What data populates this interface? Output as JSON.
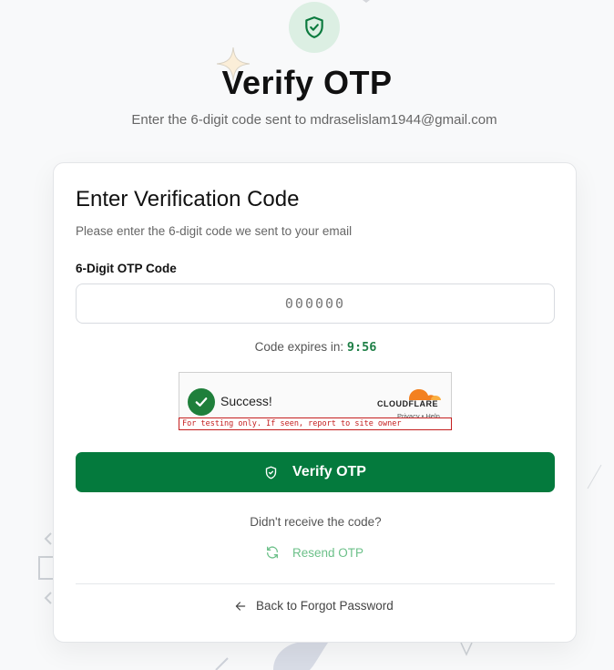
{
  "header": {
    "title": "Verify OTP",
    "subtitle": "Enter the 6-digit code sent to mdraselislam1944@gmail.com"
  },
  "card": {
    "title": "Enter Verification Code",
    "description": "Please enter the 6-digit code we sent to your email",
    "otp_label": "6-Digit OTP Code",
    "otp_placeholder": "000000",
    "otp_value": "",
    "expires_label": "Code expires in:",
    "expires_timer": "9:56"
  },
  "captcha": {
    "status": "Success!",
    "brand": "CLOUDFLARE",
    "links": "Privacy • Help",
    "warning": "For testing only. If seen, report to site owner"
  },
  "actions": {
    "verify_label": "Verify OTP",
    "didnt_receive": "Didn't receive the code?",
    "resend_label": "Resend OTP",
    "back_label": "Back to Forgot Password"
  },
  "colors": {
    "primary": "#047a3d",
    "timer": "#1e7f46",
    "resend": "#6cc089",
    "warning": "#c41e1e"
  },
  "icons": {
    "badge": "shield-check-icon",
    "verify": "shield-icon",
    "resend": "refresh-icon",
    "back": "arrow-left-icon",
    "captcha": "checkmark-icon"
  }
}
